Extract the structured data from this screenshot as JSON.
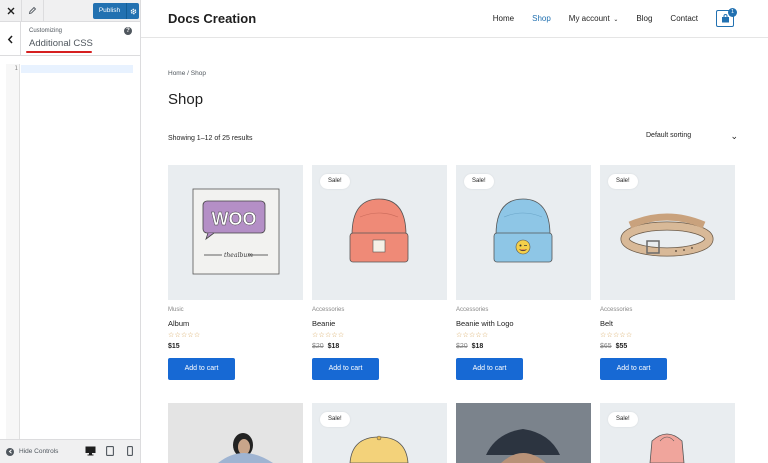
{
  "customizer": {
    "publish_label": "Publish",
    "customizing_label": "Customizing",
    "section_title": "Additional CSS",
    "line_number": "1",
    "hide_controls_label": "Hide Controls",
    "accent_color": "#2271b1",
    "highlight_color": "#d62020"
  },
  "site": {
    "title": "Docs Creation",
    "nav": [
      "Home",
      "Shop",
      "My account",
      "Blog",
      "Contact"
    ],
    "active_nav": "Shop",
    "cart_count": "1"
  },
  "shop": {
    "breadcrumb": "Home / Shop",
    "title": "Shop",
    "results": "Showing 1–12 of 25 results",
    "sorting": "Default sorting",
    "button_color": "#1769d4"
  },
  "products": [
    {
      "category": "Music",
      "name": "Album",
      "stars": "☆☆☆☆☆",
      "old_price": "",
      "price": "$15",
      "sale": "",
      "add_to_cart": "Add to cart"
    },
    {
      "category": "Accessories",
      "name": "Beanie",
      "stars": "☆☆☆☆☆",
      "old_price": "$20",
      "price": "$18",
      "sale": "Sale!",
      "add_to_cart": "Add to cart"
    },
    {
      "category": "Accessories",
      "name": "Beanie with Logo",
      "stars": "☆☆☆☆☆",
      "old_price": "$20",
      "price": "$18",
      "sale": "Sale!",
      "add_to_cart": "Add to cart"
    },
    {
      "category": "Accessories",
      "name": "Belt",
      "stars": "☆☆☆☆☆",
      "old_price": "$65",
      "price": "$55",
      "sale": "Sale!",
      "add_to_cart": "Add to cart"
    }
  ],
  "row2_sales": [
    "Sale!",
    "Sale!"
  ]
}
